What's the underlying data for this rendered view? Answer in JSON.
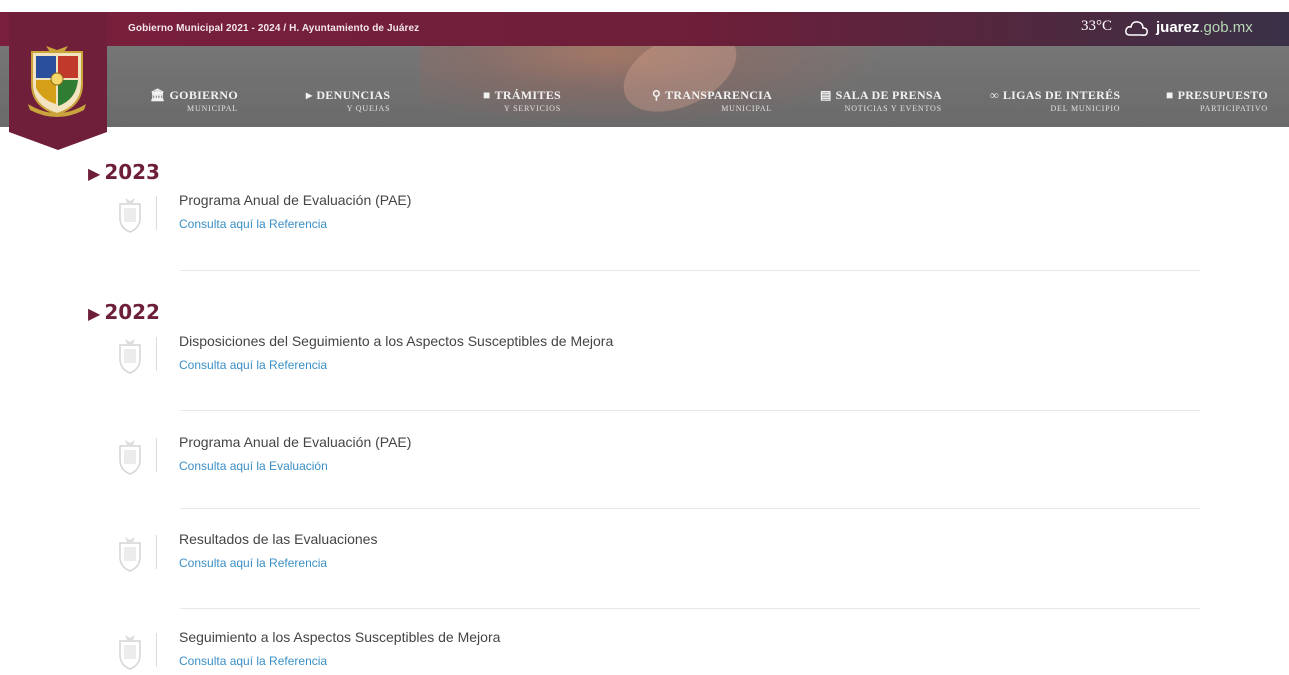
{
  "header": {
    "government_text": "Gobierno Municipal 2021 - 2024 / H. Ayuntamiento de Juárez",
    "temperature": "33°C",
    "weather_icon": "cloud-icon",
    "domain_main": "juarez",
    "domain_suffix": ".gob.mx"
  },
  "nav": {
    "items": [
      {
        "label": "GOBIERNO",
        "sub": "MUNICIPAL",
        "icon": "building-icon"
      },
      {
        "label": "DENUNCIAS",
        "sub": "Y QUEJAS",
        "icon": "megaphone-icon"
      },
      {
        "label": "TRÁMITES",
        "sub": "Y SERVICIOS",
        "icon": "book-icon"
      },
      {
        "label": "TRANSPARENCIA",
        "sub": "MUNICIPAL",
        "icon": "search-icon"
      },
      {
        "label": "SALA DE PRENSA",
        "sub": "NOTICIAS Y EVENTOS",
        "icon": "newspaper-icon"
      },
      {
        "label": "LIGAS DE INTERÉS",
        "sub": "DEL MUNICIPIO",
        "icon": "link-icon"
      },
      {
        "label": "PRESUPUESTO",
        "sub": "PARTICIPATIVO",
        "icon": "book-icon"
      }
    ]
  },
  "sections": [
    {
      "year": "2023",
      "entries": [
        {
          "title": "Programa Anual de Evaluación (PAE)",
          "link": "Consulta aquí la Referencia"
        }
      ]
    },
    {
      "year": "2022",
      "entries": [
        {
          "title": "Disposiciones del Seguimiento a los Aspectos Susceptibles de Mejora",
          "link": "Consulta aquí la Referencia"
        },
        {
          "title": "Programa Anual de Evaluación (PAE)",
          "link": "Consulta aquí la Evaluación"
        },
        {
          "title": "Resultados de las Evaluaciones",
          "link": "Consulta aquí la Referencia"
        },
        {
          "title": "Seguimiento a los Aspectos Susceptibles de Mejora",
          "link": "Consulta aquí la Referencia"
        }
      ]
    }
  ],
  "colors": {
    "brand": "#6d1f3a",
    "link": "#3a8fc5",
    "nav_bg": "#707070"
  }
}
